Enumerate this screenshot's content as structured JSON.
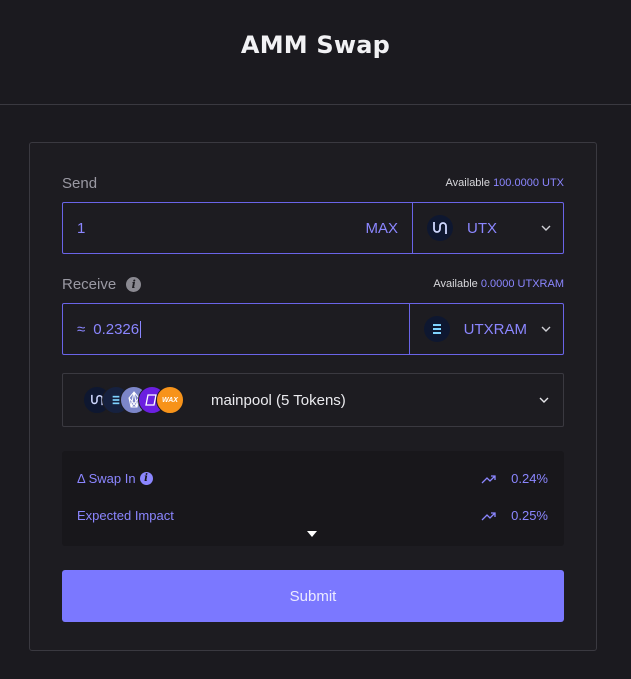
{
  "header": {
    "title": "AMM Swap"
  },
  "send": {
    "label": "Send",
    "available_prefix": "Available",
    "available_value": "100.0000 UTX",
    "amount": "1",
    "max_label": "MAX",
    "token": "UTX",
    "token_icon": "utx-logo-icon"
  },
  "receive": {
    "label": "Receive",
    "info_icon": "i",
    "available_prefix": "Available",
    "available_value": "0.0000 UTXRAM",
    "approx_symbol": "≈",
    "amount": "0.2326",
    "token": "UTXRAM",
    "token_icon": "utxram-logo-icon"
  },
  "pool": {
    "name": "mainpool (5 Tokens)",
    "token_icons": [
      "utx-logo-icon",
      "utxram-logo-icon",
      "eos-logo-icon",
      "purple-token-icon",
      "wax-logo-icon"
    ],
    "wax_text": "WAX"
  },
  "stats": {
    "swap_in_label": "Δ Swap In",
    "swap_in_info": "i",
    "swap_in_value": "0.24%",
    "impact_label": "Expected Impact",
    "impact_value": "0.25%"
  },
  "submit_label": "Submit",
  "colors": {
    "background": "#1b1a1f",
    "accent": "#8b86ff",
    "field_border": "#6a64e8",
    "submit_bg": "#7b78ff",
    "wax_orange": "#f7931a"
  }
}
